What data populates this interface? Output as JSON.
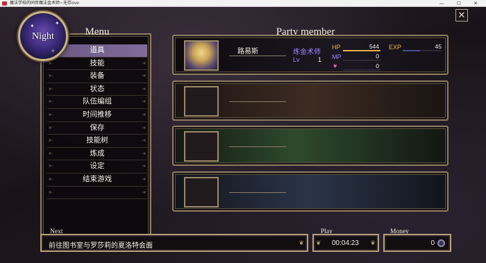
{
  "window": {
    "title": "魔法学校的同伴魔法金术师~无存ovo",
    "controls": "— ☐ ✕"
  },
  "close": {
    "label": "✕"
  },
  "emblem": {
    "label": "Night"
  },
  "menu": {
    "title": "Menu",
    "items": [
      "道具",
      "技能",
      "装备",
      "状态",
      "队伍编组",
      "时间推移",
      "保存",
      "技能树",
      "炼成",
      "设定",
      "结束游戏",
      ""
    ],
    "selected_index": 0
  },
  "party": {
    "title": "Party member",
    "members": [
      {
        "name": "路易斯",
        "class": "炼金术师",
        "lv_label": "Lv",
        "lv": "1",
        "hp_label": "HP",
        "hp": "544",
        "mp_label": "MP",
        "mp": "0",
        "heart_value": "0",
        "exp_label": "EXP",
        "exp": "45"
      }
    ],
    "empty_slots": 3
  },
  "next": {
    "label": "Next",
    "text": "前往图书室与罗莎莉的夏洛特会面"
  },
  "play": {
    "label": "Play",
    "time": "00:04:23"
  },
  "money": {
    "label": "Money",
    "value": "0"
  },
  "colors": {
    "accent_purple": "#9e86ff",
    "hp": "#e9b34a",
    "exp": "#e9b34a",
    "heart": "#ff5ecf",
    "frame_gold": "#b5a27b"
  }
}
